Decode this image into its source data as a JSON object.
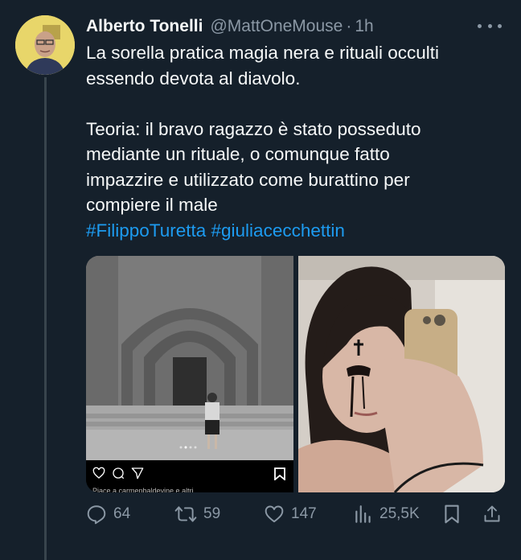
{
  "author": {
    "name": "Alberto Tonelli",
    "handle": "@MattOneMouse",
    "separator": "·",
    "time": "1h"
  },
  "tweet": {
    "lines": [
      "La sorella pratica magia nera e rituali occulti",
      "essendo devota al diavolo.",
      "Teoria: il bravo ragazzo è stato posseduto",
      "mediante un rituale, o comunque fatto",
      "impazzire e utilizzato come burattino per",
      "compiere il male"
    ],
    "hashtags": [
      "#FilippoTuretta",
      "#giuliacecchettin"
    ]
  },
  "media": {
    "left_caption": "Piace a carmenbaldevine e altri",
    "left_icons": [
      "heart-outline-icon",
      "comment-bubble-icon",
      "send-icon",
      "bookmark-icon"
    ]
  },
  "actions": {
    "replies": "64",
    "reposts": "59",
    "likes": "147",
    "views": "25,5K"
  },
  "colors": {
    "background": "#15202b",
    "text": "#f7f9f9",
    "secondary": "#8b98a5",
    "link": "#1d9bf0"
  }
}
